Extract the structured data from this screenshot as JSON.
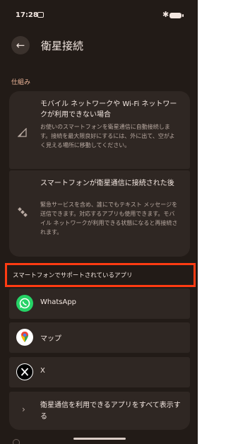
{
  "status_bar": {
    "time": "17:28"
  },
  "header": {
    "title": "衛星接続"
  },
  "section": {
    "label": "仕組み"
  },
  "cards": [
    {
      "title": "モバイル ネットワークや Wi-Fi ネットワークが利用できない場合",
      "description": "お使いのスマートフォンを衛星通信に自動接続します。接続を最大限良好にするには、外に出て、空がよく見える場所に移動してください。",
      "icon": "satellite-signal-icon"
    },
    {
      "title": "スマートフォンが衛星通信に接続された後",
      "description": "緊急サービスを含め、誰にでもテキスト メッセージを送信できます。対応するアプリも使用できます。モバイル ネットワークが利用できる状態になると再接続されます。",
      "icon": "satellite-icon"
    }
  ],
  "supported_apps": {
    "header": "スマートフォンでサポートされているアプリ",
    "items": [
      {
        "label": "WhatsApp",
        "icon": "whatsapp-icon"
      },
      {
        "label": "マップ",
        "icon": "google-maps-icon"
      },
      {
        "label": "X",
        "icon": "x-icon"
      }
    ],
    "show_all": "衛星通信を利用できるアプリをすべて表示する"
  },
  "colors": {
    "background": "#221b17",
    "card": "#2f2723",
    "accent": "#f0b89b",
    "highlight": "#ff3b12"
  }
}
